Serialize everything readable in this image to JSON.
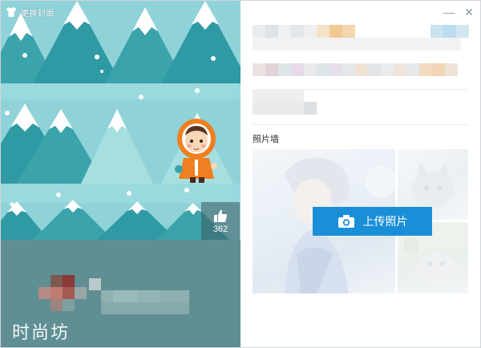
{
  "topbar": {
    "change_skin_label": "更换封面"
  },
  "like": {
    "count": "362"
  },
  "brand": {
    "text": "时尚坊"
  },
  "window_controls": {
    "minimize": "—",
    "close": "✕"
  },
  "photo_wall": {
    "title": "照片墙",
    "upload_label": "上传照片"
  },
  "colors": {
    "accent": "#1a8fd8",
    "sky": "#8fd3d9",
    "tree_dark": "#2f9aa3",
    "tree_light": "#a6dfe0",
    "profile_bg": "#5f8f93"
  },
  "icons": {
    "skin": "shirt-icon",
    "like": "thumbs-up-icon",
    "upload": "camera-icon",
    "minimize": "minimize-icon",
    "close": "close-icon"
  }
}
